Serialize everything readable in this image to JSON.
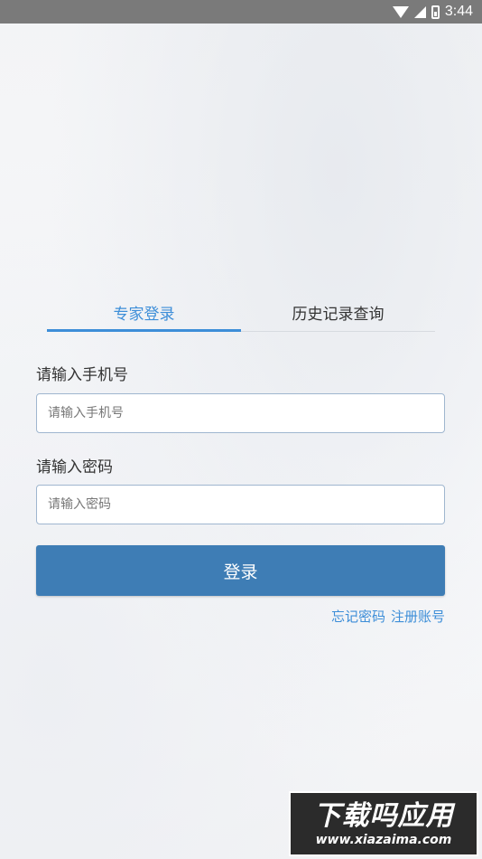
{
  "status_bar": {
    "time": "3:44",
    "icons": [
      "wifi-icon",
      "signal-icon",
      "battery-icon"
    ]
  },
  "tabs": [
    {
      "label": "专家登录",
      "active": true
    },
    {
      "label": "历史记录查询",
      "active": false
    }
  ],
  "form": {
    "phone_label": "请输入手机号",
    "phone_placeholder": "请输入手机号",
    "phone_value": "",
    "password_label": "请输入密码",
    "password_placeholder": "请输入密码",
    "password_value": "",
    "login_button": "登录"
  },
  "links": {
    "forgot_password": "忘记密码",
    "register": "注册账号"
  },
  "watermark": {
    "title": "下载吗应用",
    "url": "www.xiazaima.com"
  },
  "colors": {
    "accent": "#3d8ed8",
    "button": "#3e7db5",
    "status_bar": "#7a7a7a"
  }
}
